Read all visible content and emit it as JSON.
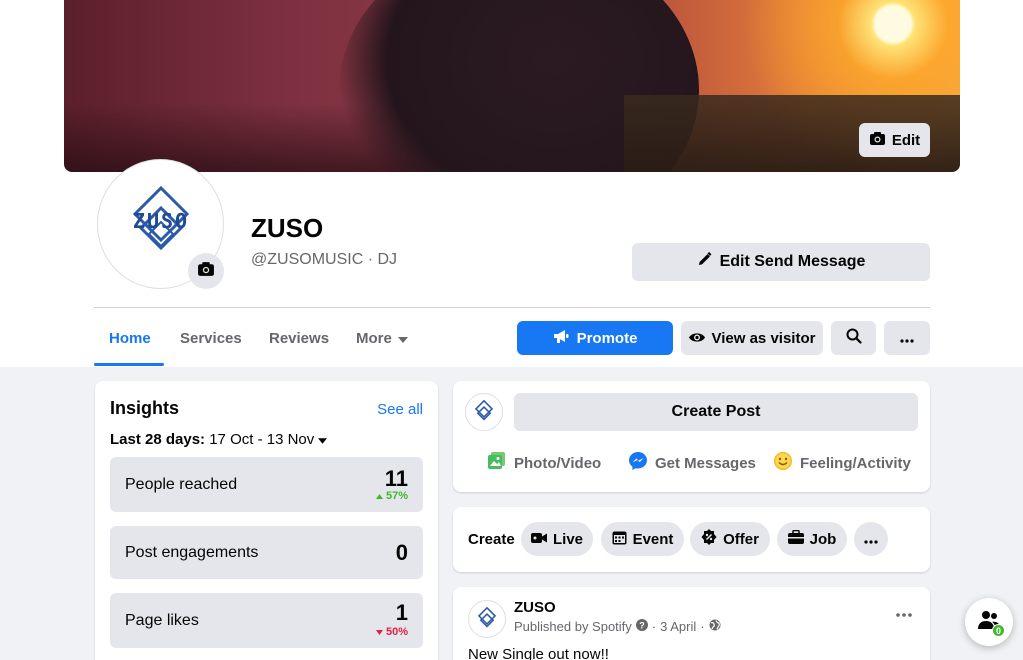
{
  "cover": {
    "edit_label": "Edit"
  },
  "profile": {
    "name": "ZUSO",
    "handle": "@ZUSOMUSIC · DJ",
    "logo_text": "ZUSO",
    "edit_send_message_label": "Edit Send Message"
  },
  "tabs": [
    {
      "label": "Home",
      "active": true
    },
    {
      "label": "Services",
      "active": false
    },
    {
      "label": "Reviews",
      "active": false
    },
    {
      "label": "More",
      "active": false
    }
  ],
  "actions": {
    "promote_label": "Promote",
    "view_as_visitor_label": "View as visitor"
  },
  "insights": {
    "title": "Insights",
    "see_all": "See all",
    "range_label": "Last 28 days:",
    "range_value": "17 Oct - 13 Nov",
    "stats": [
      {
        "label": "People reached",
        "value": "11",
        "delta": "57%",
        "direction": "up"
      },
      {
        "label": "Post engagements",
        "value": "0",
        "delta": "",
        "direction": "none"
      },
      {
        "label": "Page likes",
        "value": "1",
        "delta": "50%",
        "direction": "down"
      }
    ]
  },
  "composer": {
    "create_post_label": "Create Post",
    "actions": [
      {
        "label": "Photo/Video",
        "icon": "photo-video-icon"
      },
      {
        "label": "Get Messages",
        "icon": "messenger-icon"
      },
      {
        "label": "Feeling/Activity",
        "icon": "smiley-icon"
      }
    ]
  },
  "create_bar": {
    "label": "Create",
    "chips": [
      {
        "label": "Live",
        "icon": "live-video-icon"
      },
      {
        "label": "Event",
        "icon": "calendar-icon"
      },
      {
        "label": "Offer",
        "icon": "percent-tag-icon"
      },
      {
        "label": "Job",
        "icon": "briefcase-icon"
      }
    ]
  },
  "post": {
    "author": "ZUSO",
    "published_by": "Published by Spotify",
    "date": "3 April",
    "text": "New Single out now!!"
  },
  "float_badge": {
    "count": "0"
  },
  "colors": {
    "accent": "#1877f2",
    "positive": "#42b72a",
    "negative": "#e41e3f",
    "button_grey": "#e4e6eb",
    "page_bg": "#f0f2f5"
  }
}
